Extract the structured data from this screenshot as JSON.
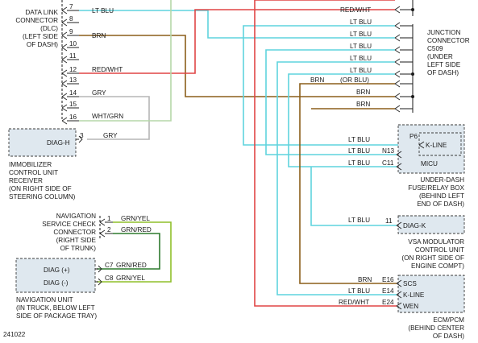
{
  "dlc": {
    "label": [
      "DATA LINK",
      "CONNECTOR",
      "(DLC)",
      "(LEFT SIDE",
      "OF DASH)"
    ]
  },
  "dlc_pins": [
    "7",
    "8",
    "9",
    "10",
    "11",
    "12",
    "13",
    "14",
    "15",
    "16"
  ],
  "dlc_wires": {
    "w7": "LT BLU",
    "w9": "BRN",
    "w12": "RED/WHT",
    "w14": "GRY",
    "w16": "WHT/GRN"
  },
  "junction": {
    "label": [
      "JUNCTION",
      "CONNECTOR",
      "C509",
      "(UNDER",
      "LEFT SIDE",
      "OF DASH)"
    ],
    "wires": [
      "RED/WHT",
      "LT BLU",
      "LT BLU",
      "LT BLU",
      "LT BLU",
      "LT BLU",
      "BRN",
      "BRN",
      "BRN"
    ],
    "orblu": "(OR BLU)",
    "brn_left": "BRN"
  },
  "immobilizer": {
    "pin_name": "DIAG-H",
    "pin": "3",
    "wire": "GRY",
    "label": [
      "IMMOBILIZER",
      "CONTROL UNIT",
      "RECEIVER",
      "(ON RIGHT SIDE OF",
      "STEERING COLUMN)"
    ]
  },
  "micu": {
    "pins": [
      "P6",
      "N13",
      "C11"
    ],
    "kline": "K-LINE",
    "name": "MICU",
    "wires": [
      "LT BLU",
      "LT BLU",
      "LT BLU"
    ],
    "label": [
      "UNDER-DASH",
      "FUSE/RELAY BOX",
      "(BEHIND LEFT",
      "END OF DASH)"
    ]
  },
  "vsa": {
    "pin": "11",
    "pin_name": "DIAG-K",
    "wire": "LT BLU",
    "label": [
      "VSA MODULATOR",
      "CONTROL UNIT",
      "(ON RIGHT SIDE OF",
      "ENGINE COMPT)"
    ]
  },
  "ecm": {
    "pins": [
      "E16",
      "E14",
      "E24"
    ],
    "names": [
      "SCS",
      "K-LINE",
      "WEN"
    ],
    "wires": [
      "BRN",
      "LT BLU",
      "RED/WHT"
    ],
    "label": [
      "ECM/PCM",
      "(BEHIND CENTER",
      "OF DASH)"
    ]
  },
  "nav_check": {
    "pins": [
      "1",
      "2"
    ],
    "wires": [
      "GRN/YEL",
      "GRN/RED"
    ],
    "label": [
      "NAVIGATION",
      "SERVICE CHECK",
      "CONNECTOR",
      "(RIGHT SIDE",
      "OF TRUNK)"
    ]
  },
  "nav_unit": {
    "pins": [
      "DIAG (+)",
      "DIAG (-)"
    ],
    "pin_ids": [
      "C7",
      "C8"
    ],
    "wires": [
      "GRN/RED",
      "GRN/YEL"
    ],
    "label": [
      "NAVIGATION UNIT",
      "(IN TRUCK, BELOW LEFT",
      "SIDE OF PACKAGE TRAY)"
    ]
  },
  "footer": {
    "code": "241022"
  },
  "colors": {
    "lt_blu": "#5fd4dd",
    "brn": "#8b5e1a",
    "red_wht": "#e04545",
    "gry": "#b5b5b5",
    "wht_grn": "#b6d7a8",
    "grn_yel": "#8fbf2a",
    "grn_red": "#2f7a2f",
    "box": "#dfe8ef"
  }
}
